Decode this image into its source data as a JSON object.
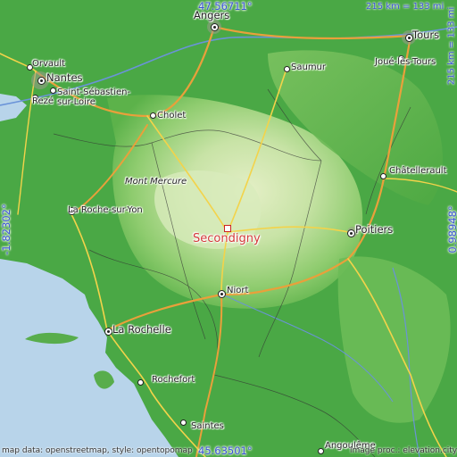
{
  "map": {
    "center_place": "Secondigny",
    "coordinates": {
      "top": "47.56711°",
      "bottom": "45.63501°",
      "left": "-1.82302°",
      "right": "0.98948°"
    },
    "scale": {
      "horizontal": "215 km = 133 mi",
      "vertical": "215 km = 133 mi"
    },
    "attribution": {
      "left": "map data: openstreetmap, style: opentopomap",
      "right": "image proc.: elevation.city"
    },
    "colors": {
      "sea": "#b8d4ea",
      "lowland": "#3fa83a",
      "upland": "#b9dc9a",
      "highland": "#d7e9b9",
      "center_marker": "#d43a3a",
      "coord_text": "#3b54d6"
    },
    "places": [
      {
        "name": "Angers"
      },
      {
        "name": "Tours"
      },
      {
        "name": "Orvault"
      },
      {
        "name": "Nantes"
      },
      {
        "name": "Saint-Sébastien-\nsur-Loire"
      },
      {
        "name": "Rezé"
      },
      {
        "name": "Saumur"
      },
      {
        "name": "Joué-lès-Tours"
      },
      {
        "name": "Cholet"
      },
      {
        "name": "Châtellerault"
      },
      {
        "name": "Mont Mercure"
      },
      {
        "name": "La Roche-sur-Yon"
      },
      {
        "name": "Poitiers"
      },
      {
        "name": "Niort"
      },
      {
        "name": "La Rochelle"
      },
      {
        "name": "Rochefort"
      },
      {
        "name": "Saintes"
      },
      {
        "name": "Angoulême"
      }
    ]
  }
}
